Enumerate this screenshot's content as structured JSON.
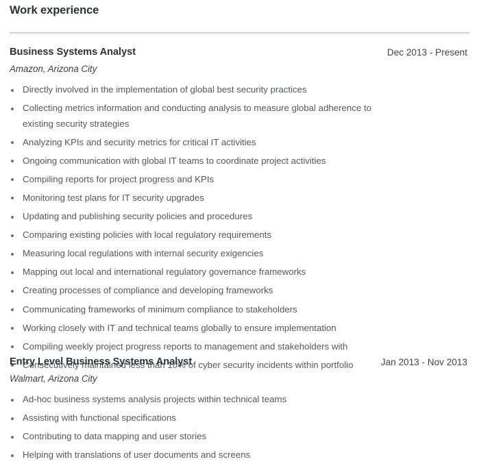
{
  "section": {
    "title": "Work experience"
  },
  "jobs": [
    {
      "title": "Business Systems Analyst",
      "dates": "Dec 2013 - Present",
      "company": "Amazon, Arizona City",
      "bullets": [
        "Directly involved in the implementation of global best security practices",
        "Collecting metrics information and conducting analysis to measure global adherence to existing security strategies",
        "Analyzing KPIs and security metrics for critical IT activities",
        "Ongoing communication with global IT teams to coordinate project activities",
        "Compiling reports for project progress and KPIs",
        "Monitoring test plans for IT security upgrades",
        "Updating and publishing security policies and procedures",
        "Comparing existing policies with local regulatory requirements",
        "Measuring local regulations with internal security exigencies",
        "Mapping out local and international regulatory governance frameworks",
        "Creating processes of compliance and developing frameworks",
        "Communicating frameworks of minimum compliance to stakeholders",
        "Working closely with IT and technical teams globally to ensure implementation",
        "Compiling weekly project progress reports to management and stakeholders with",
        "Consecutively maintained less than 10% of cyber security incidents within portfolio"
      ]
    },
    {
      "title": "Entry Level Business Systems Analyst",
      "dates": "Jan 2013 - Nov 2013",
      "company": "Walmart, Arizona City",
      "bullets": [
        "Ad-hoc business systems analysis projects within technical teams",
        "Assisting with functional specifications",
        "Contributing to data mapping and user stories",
        "Helping with translations of user documents and screens"
      ]
    }
  ],
  "colors": {
    "heading": "#2e3136",
    "body": "#55595e",
    "divider": "#cfd0d1",
    "bullet": "#6c7075",
    "background": "#ffffff"
  }
}
